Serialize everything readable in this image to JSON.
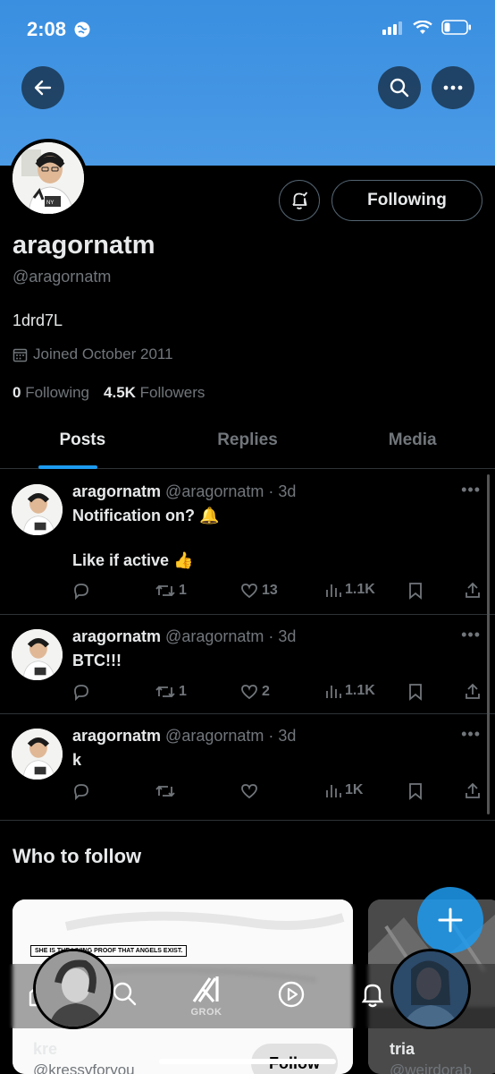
{
  "status_bar": {
    "time": "2:08"
  },
  "profile": {
    "name": "aragornatm",
    "handle": "@aragornatm",
    "bio": "1drd7L",
    "joined": "Joined October 2011",
    "following_count": "0",
    "following_label": "Following",
    "followers_count": "4.5K",
    "followers_label": "Followers",
    "following_button": "Following"
  },
  "tabs": [
    {
      "label": "Posts",
      "active": true
    },
    {
      "label": "Replies",
      "active": false
    },
    {
      "label": "Media",
      "active": false
    }
  ],
  "posts": [
    {
      "user": "aragornatm",
      "handle": "@aragornatm",
      "time": "· 3d",
      "line1": "Notification on? 🔔",
      "line2": "Like if active 👍",
      "replies": "",
      "reposts": "1",
      "likes": "13",
      "views": "1.1K"
    },
    {
      "user": "aragornatm",
      "handle": "@aragornatm",
      "time": "· 3d",
      "line1": "BTC!!!",
      "line2": "",
      "replies": "",
      "reposts": "1",
      "likes": "2",
      "views": "1.1K"
    },
    {
      "user": "aragornatm",
      "handle": "@aragornatm",
      "time": "· 3d",
      "line1": "k",
      "line2": "",
      "replies": "",
      "reposts": "",
      "likes": "",
      "views": "1K"
    }
  ],
  "who_to_follow": {
    "title": "Who to follow",
    "card1_caption": "SHE IS THE LIVING PROOF THAT ANGELS EXIST.",
    "suggestions": [
      {
        "name": "kre",
        "handle": "@kressyforyou"
      },
      {
        "name": "tria",
        "handle": "@weirdorab"
      }
    ],
    "follow_label": "Follow"
  },
  "nav": {
    "grok_label": "GROK"
  },
  "colors": {
    "accent": "#1d9bf0",
    "banner": "#4a9ae6",
    "muted": "#71767b",
    "text": "#e7e9ea"
  }
}
